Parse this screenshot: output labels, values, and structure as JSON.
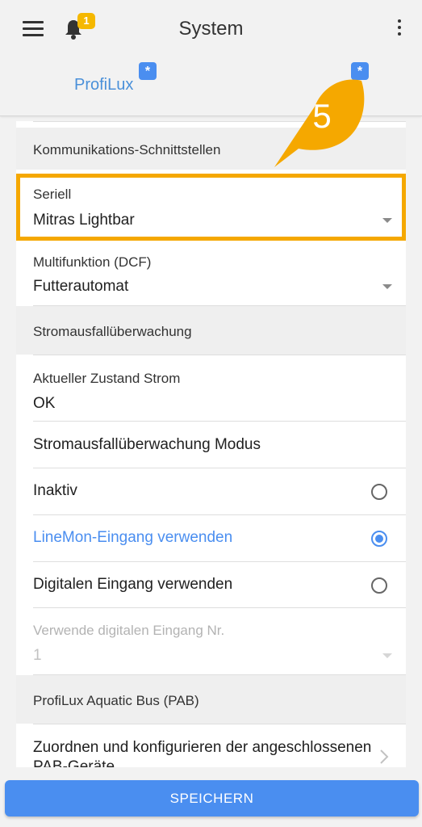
{
  "header": {
    "title": "System",
    "notification_count": "1",
    "tabs": [
      {
        "label": "ProfiLux",
        "badge": "*"
      },
      {
        "label": "",
        "badge": "*"
      }
    ]
  },
  "callout": {
    "number": "5"
  },
  "sections": {
    "communication": "Kommunikations-Schnittstellen",
    "power": "Stromausfallüberwachung",
    "pab": "ProfiLux Aquatic Bus (PAB)"
  },
  "fields": {
    "serial": {
      "label": "Seriell",
      "value": "Mitras Lightbar"
    },
    "multifunction": {
      "label": "Multifunktion (DCF)",
      "value": "Futterautomat"
    },
    "power_state": {
      "label": "Aktueller Zustand Strom",
      "value": "OK"
    },
    "monitor_mode_title": "Stromausfallüberwachung Modus",
    "digital_input": {
      "label": "Verwende digitalen Eingang Nr.",
      "value": "1"
    },
    "pab_link": "Zuordnen und konfigurieren der angeschlossenen PAB-Geräte"
  },
  "radio_options": [
    {
      "label": "Inaktiv",
      "checked": false
    },
    {
      "label": "LineMon-Eingang verwenden",
      "checked": true
    },
    {
      "label": "Digitalen Eingang verwenden",
      "checked": false
    }
  ],
  "footer": {
    "save_label": "SPEICHERN"
  },
  "colors": {
    "accent": "#4a8ef0",
    "highlight": "#f5a800",
    "badge": "#f5b800"
  }
}
